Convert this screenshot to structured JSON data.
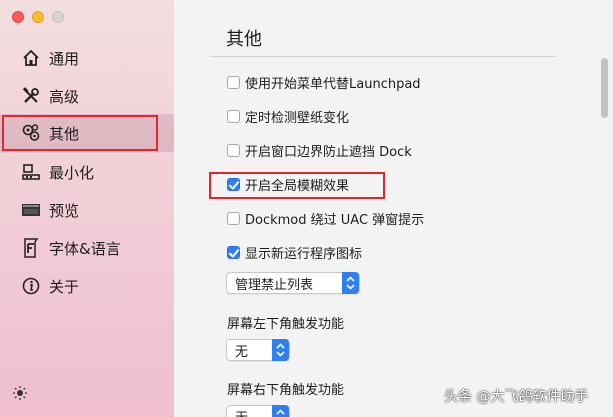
{
  "colors": {
    "accent": "#2f7ff1",
    "highlight_box": "#e3262c",
    "sidebar_top": "#f2dede",
    "sidebar_bottom": "#f0bfd0"
  },
  "sidebar": {
    "items": [
      {
        "label": "通用",
        "icon": "house-icon"
      },
      {
        "label": "高级",
        "icon": "tools-icon"
      },
      {
        "label": "其他",
        "icon": "gears-icon",
        "selected": true
      },
      {
        "label": "最小化",
        "icon": "dock-minimize-icon"
      },
      {
        "label": "预览",
        "icon": "preview-icon"
      },
      {
        "label": "字体&语言",
        "icon": "font-icon"
      },
      {
        "label": "关于",
        "icon": "info-icon"
      }
    ],
    "bottom_icon": "sun-icon"
  },
  "main": {
    "title": "其他",
    "options": [
      {
        "label": "使用开始菜单代替Launchpad",
        "checked": false
      },
      {
        "label": "定时检测壁纸变化",
        "checked": false
      },
      {
        "label": "开启窗口边界防止遮挡 Dock",
        "checked": false
      },
      {
        "label": "开启全局模糊效果",
        "checked": true
      },
      {
        "label": "Dockmod 绕过 UAC 弹窗提示",
        "checked": false
      },
      {
        "label": "显示新运行程序图标",
        "checked": true
      }
    ],
    "manage_button": "管理禁止列表",
    "bottom_left_label": "屏幕左下角触发功能",
    "bottom_left_value": "无",
    "bottom_right_label": "屏幕右下角触发功能",
    "bottom_right_value": "无"
  },
  "watermark": "头条 @大飞鸽软件助手"
}
